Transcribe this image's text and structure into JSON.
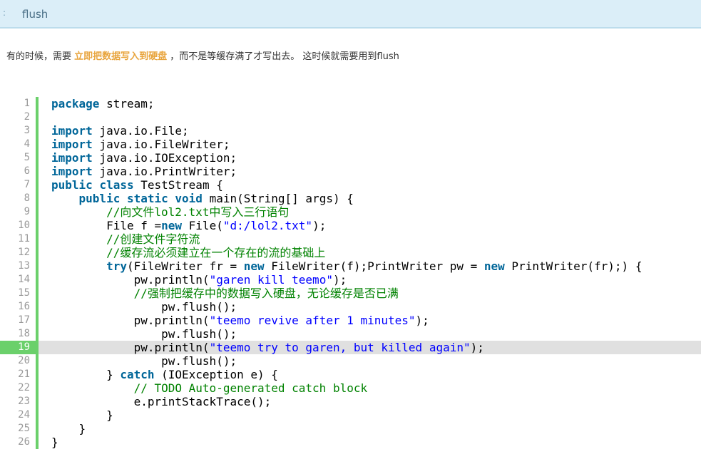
{
  "header": {
    "marker": ":",
    "title": "flush"
  },
  "description": {
    "before": "有的时候，需要 ",
    "highlight": "立即把数据写入到硬盘",
    "after": " ，而不是等缓存满了才写出去。 这时候就需要用到flush"
  },
  "colors": {
    "keyword": "#006699",
    "string": "#0000ff",
    "comment": "#008200",
    "gutter_active": "#6bd06b",
    "highlight": "#e8a43c",
    "header_bg": "#dbeef8"
  },
  "code": {
    "current_line": 19,
    "lines": [
      [
        [
          "kw",
          "package"
        ],
        [
          "pl",
          " stream;"
        ]
      ],
      [],
      [
        [
          "kw",
          "import"
        ],
        [
          "pl",
          " java.io.File;"
        ]
      ],
      [
        [
          "kw",
          "import"
        ],
        [
          "pl",
          " java.io.FileWriter;"
        ]
      ],
      [
        [
          "kw",
          "import"
        ],
        [
          "pl",
          " java.io.IOException;"
        ]
      ],
      [
        [
          "kw",
          "import"
        ],
        [
          "pl",
          " java.io.PrintWriter;"
        ]
      ],
      [
        [
          "kw",
          "public"
        ],
        [
          "pl",
          " "
        ],
        [
          "kw",
          "class"
        ],
        [
          "pl",
          " TestStream {"
        ]
      ],
      [
        [
          "pl",
          "    "
        ],
        [
          "kw",
          "public"
        ],
        [
          "pl",
          " "
        ],
        [
          "kw",
          "static"
        ],
        [
          "pl",
          " "
        ],
        [
          "kw",
          "void"
        ],
        [
          "pl",
          " main(String[] args) {"
        ]
      ],
      [
        [
          "pl",
          "        "
        ],
        [
          "cm",
          "//向文件lol2.txt中写入三行语句"
        ]
      ],
      [
        [
          "pl",
          "        File f ="
        ],
        [
          "kw",
          "new"
        ],
        [
          "pl",
          " File("
        ],
        [
          "str",
          "\"d:/lol2.txt\""
        ],
        [
          "pl",
          ");"
        ]
      ],
      [
        [
          "pl",
          "        "
        ],
        [
          "cm",
          "//创建文件字符流"
        ]
      ],
      [
        [
          "pl",
          "        "
        ],
        [
          "cm",
          "//缓存流必须建立在一个存在的流的基础上"
        ]
      ],
      [
        [
          "pl",
          "        "
        ],
        [
          "kw",
          "try"
        ],
        [
          "pl",
          "(FileWriter fr = "
        ],
        [
          "kw",
          "new"
        ],
        [
          "pl",
          " FileWriter(f);PrintWriter pw = "
        ],
        [
          "kw",
          "new"
        ],
        [
          "pl",
          " PrintWriter(fr);) {"
        ]
      ],
      [
        [
          "pl",
          "            pw.println("
        ],
        [
          "str",
          "\"garen kill teemo\""
        ],
        [
          "pl",
          ");"
        ]
      ],
      [
        [
          "pl",
          "            "
        ],
        [
          "cm",
          "//强制把缓存中的数据写入硬盘，无论缓存是否已满"
        ]
      ],
      [
        [
          "pl",
          "                pw.flush();"
        ]
      ],
      [
        [
          "pl",
          "            pw.println("
        ],
        [
          "str",
          "\"teemo revive after 1 minutes\""
        ],
        [
          "pl",
          ");"
        ]
      ],
      [
        [
          "pl",
          "                pw.flush();"
        ]
      ],
      [
        [
          "pl",
          "            pw.println("
        ],
        [
          "str",
          "\"teemo try to garen, but killed again\""
        ],
        [
          "pl",
          ");"
        ]
      ],
      [
        [
          "pl",
          "                pw.flush();"
        ]
      ],
      [
        [
          "pl",
          "        } "
        ],
        [
          "kw",
          "catch"
        ],
        [
          "pl",
          " (IOException e) {"
        ]
      ],
      [
        [
          "pl",
          "            "
        ],
        [
          "cm",
          "// TODO Auto-generated catch block"
        ]
      ],
      [
        [
          "pl",
          "            e.printStackTrace();"
        ]
      ],
      [
        [
          "pl",
          "        }"
        ]
      ],
      [
        [
          "pl",
          "    }"
        ]
      ],
      [
        [
          "pl",
          "}"
        ]
      ]
    ]
  }
}
